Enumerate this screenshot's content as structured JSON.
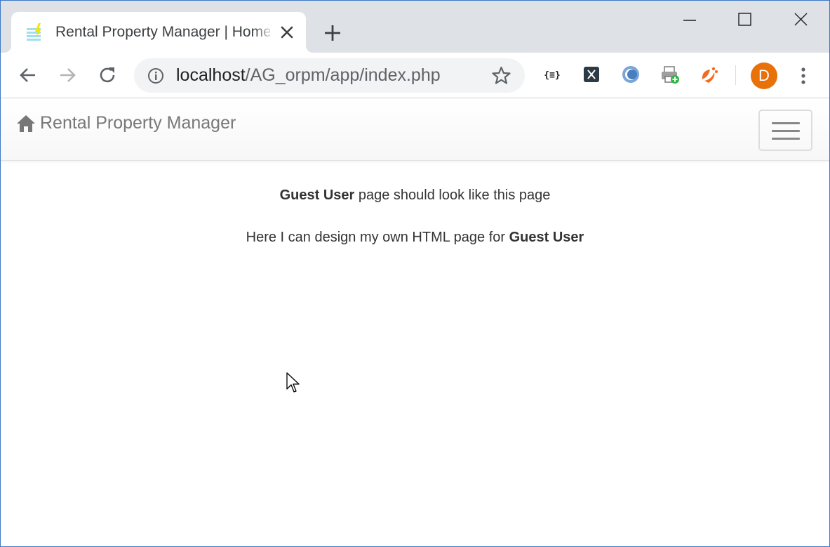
{
  "browser": {
    "tab_title": "Rental Property Manager | Home",
    "url_host": "localhost",
    "url_path": "/AG_orpm/app/index.php",
    "profile_initial": "D",
    "extensions": [
      "json-viewer-icon",
      "x-extension-icon",
      "circle-extension-icon",
      "print-add-icon",
      "mango-extension-icon"
    ]
  },
  "navbar": {
    "brand": "Rental Property Manager"
  },
  "content": {
    "line1_bold": "Guest User",
    "line1_rest": " page should look like this page",
    "line2_text": "Here I can design my own HTML page for ",
    "line2_bold": "Guest User"
  },
  "colors": {
    "tabstrip": "#dee1e6",
    "avatar": "#e8710a",
    "brand_text": "#777777"
  }
}
